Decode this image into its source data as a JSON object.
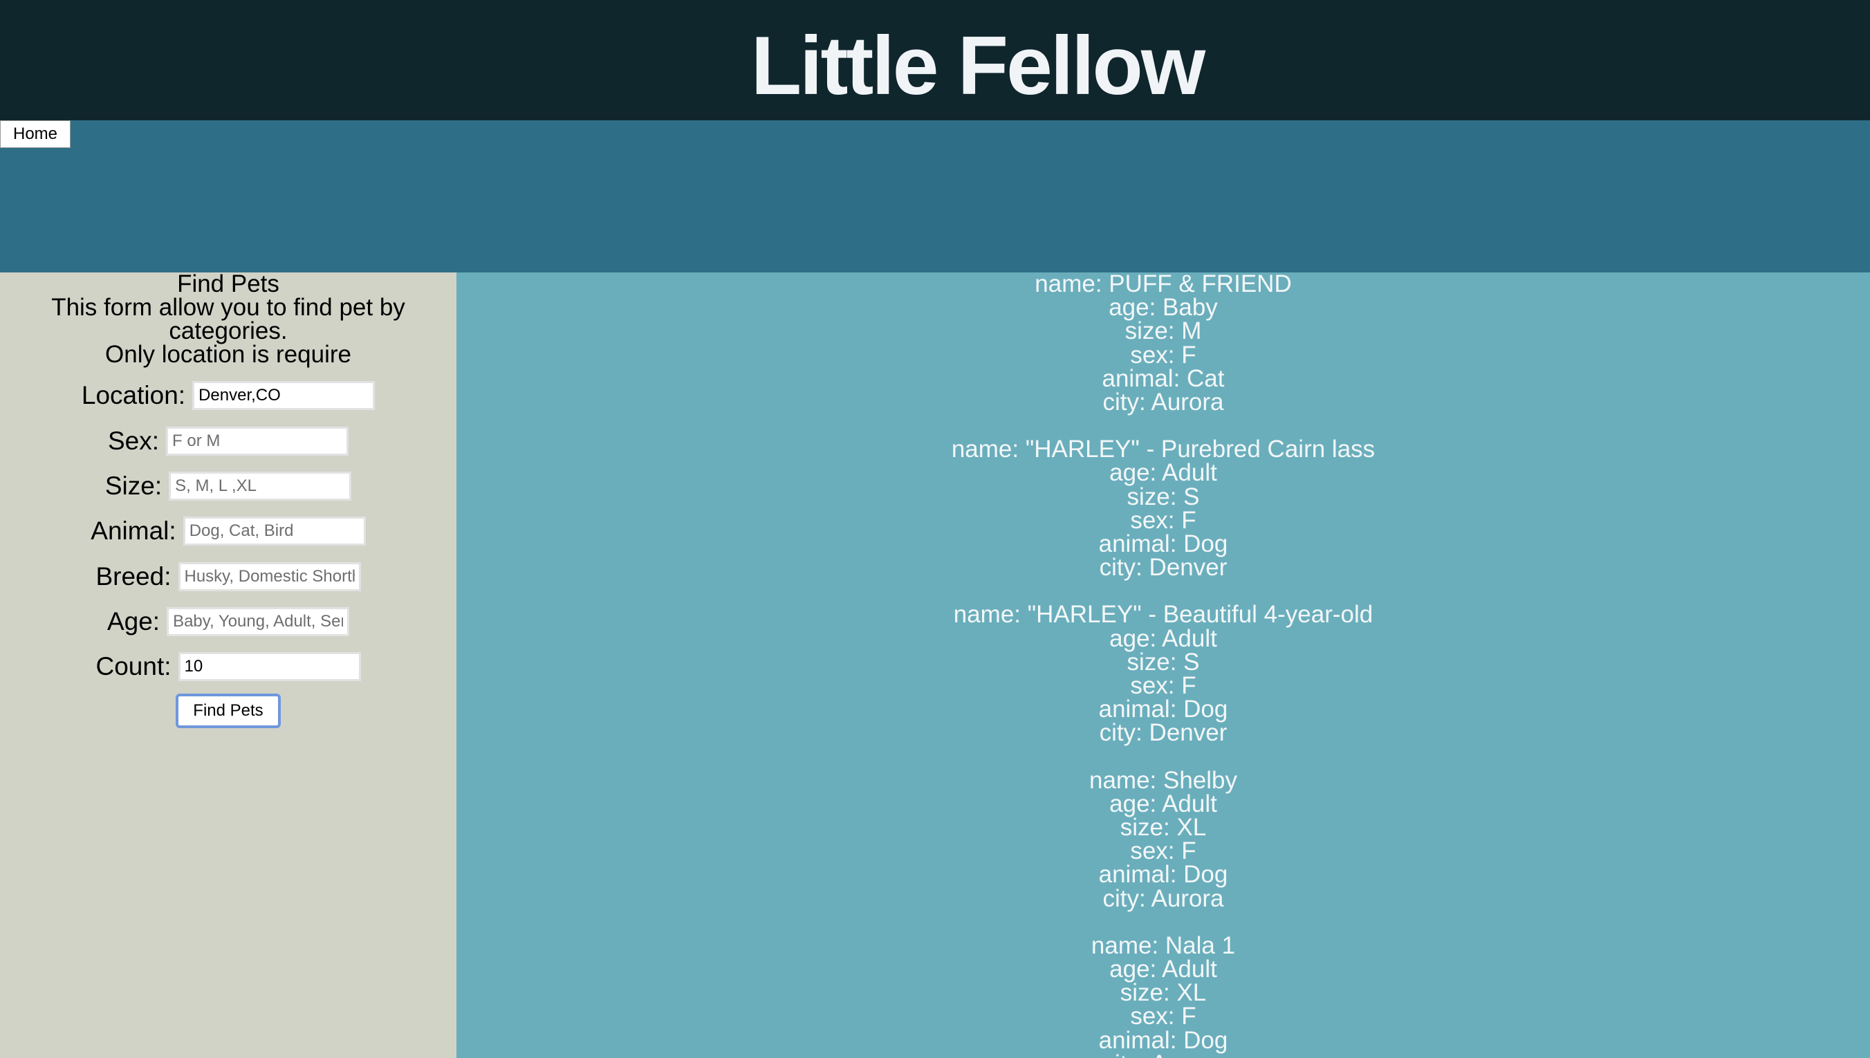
{
  "header": {
    "title": "Little Fellow"
  },
  "nav": {
    "home_label": "Home"
  },
  "form": {
    "heading": "Find Pets",
    "description": "This form allow you to find pet by categories.",
    "note": "Only location is require",
    "fields": {
      "location": {
        "label": "Location:",
        "value": "Denver,CO",
        "placeholder": ""
      },
      "sex": {
        "label": "Sex:",
        "value": "",
        "placeholder": "F or M"
      },
      "size": {
        "label": "Size:",
        "value": "",
        "placeholder": "S, M, L ,XL"
      },
      "animal": {
        "label": "Animal:",
        "value": "",
        "placeholder": "Dog, Cat, Bird"
      },
      "breed": {
        "label": "Breed:",
        "value": "",
        "placeholder": "Husky, Domestic Shorthair"
      },
      "age": {
        "label": "Age:",
        "value": "",
        "placeholder": "Baby, Young, Adult, Senior"
      },
      "count": {
        "label": "Count:",
        "value": "10",
        "placeholder": ""
      }
    },
    "submit_label": "Find Pets"
  },
  "results": [
    {
      "name": "name: PUFF & FRIEND",
      "age": "age: Baby",
      "size": "size: M",
      "sex": "sex: F",
      "animal": "animal: Cat",
      "city": "city: Aurora"
    },
    {
      "name": "name: \"HARLEY\" - Purebred Cairn lass",
      "age": "age: Adult",
      "size": "size: S",
      "sex": "sex: F",
      "animal": "animal: Dog",
      "city": "city: Denver"
    },
    {
      "name": "name: \"HARLEY\" - Beautiful 4-year-old",
      "age": "age: Adult",
      "size": "size: S",
      "sex": "sex: F",
      "animal": "animal: Dog",
      "city": "city: Denver"
    },
    {
      "name": "name: Shelby",
      "age": "age: Adult",
      "size": "size: XL",
      "sex": "sex: F",
      "animal": "animal: Dog",
      "city": "city: Aurora"
    },
    {
      "name": "name: Nala 1",
      "age": "age: Adult",
      "size": "size: XL",
      "sex": "sex: F",
      "animal": "animal: Dog",
      "city": "city: Aurora"
    }
  ],
  "colors": {
    "header_bg": "#10262d",
    "banner_bg": "#2e6f87",
    "sidebar_bg": "#d1d3c7",
    "results_bg": "#6aaebc",
    "button_focus": "#6f97dc"
  }
}
